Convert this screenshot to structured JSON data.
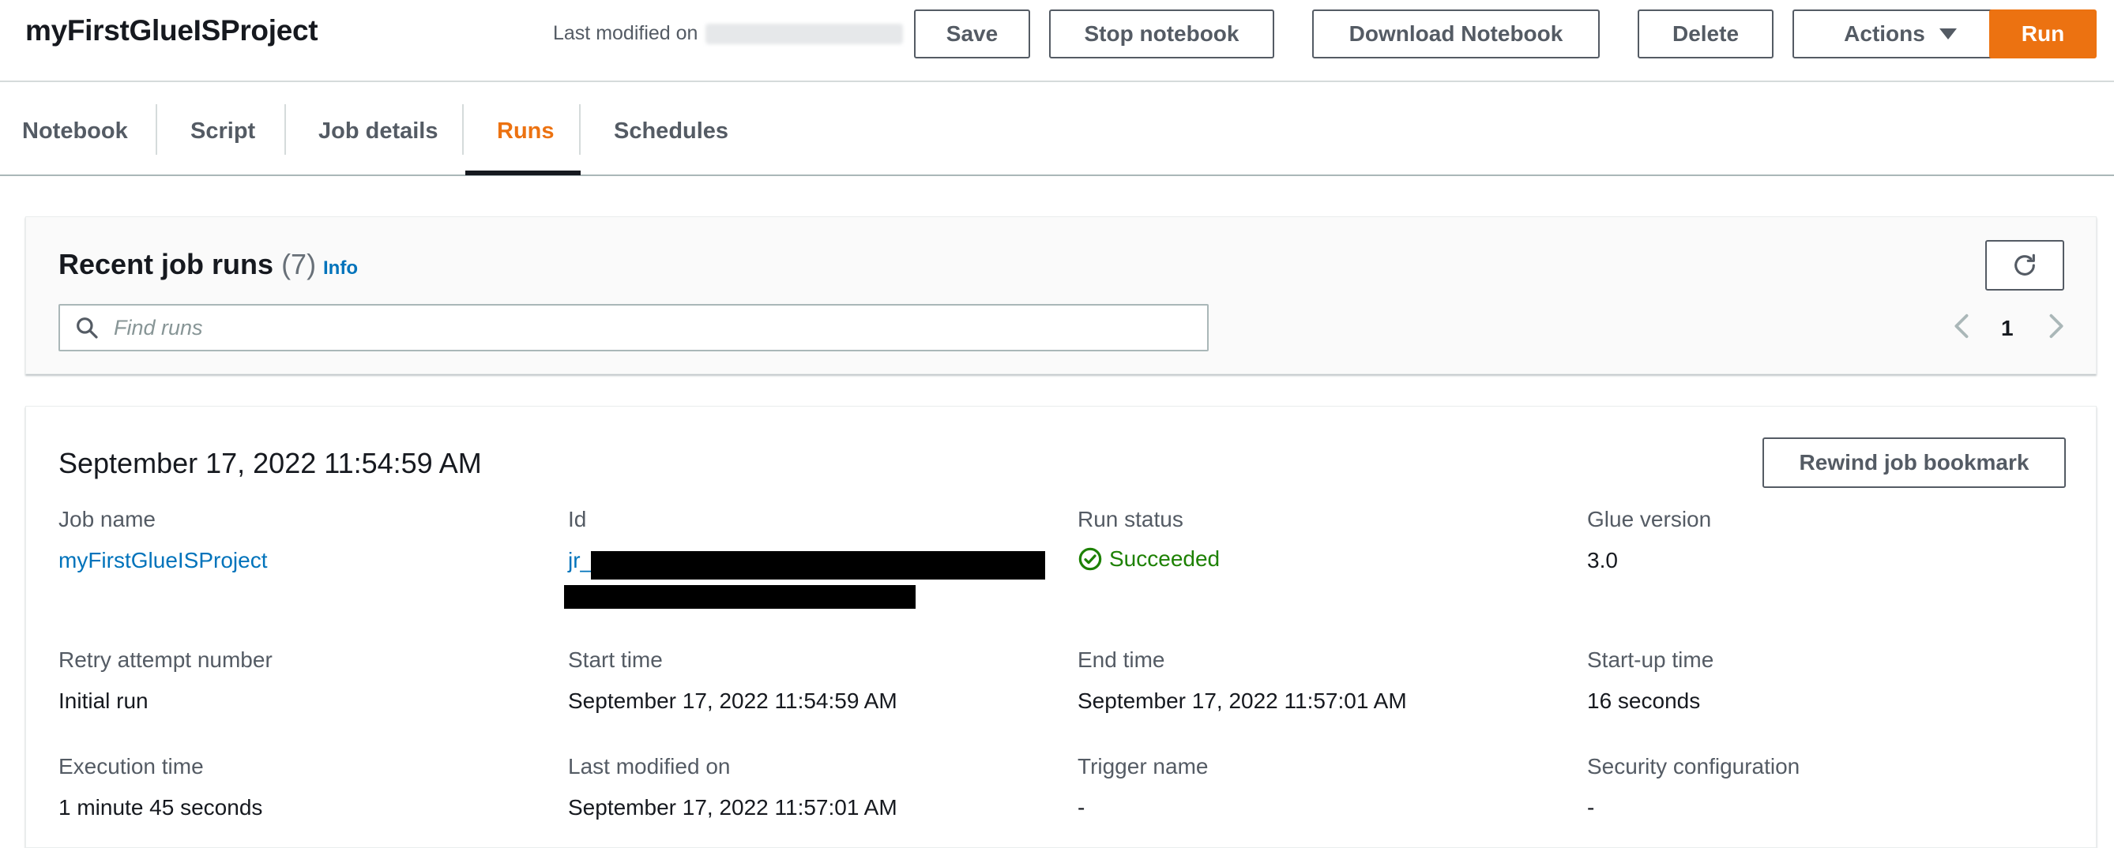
{
  "header": {
    "title": "myFirstGlueISProject",
    "last_modified_label": "Last modified on",
    "buttons": {
      "save": "Save",
      "stop_notebook": "Stop notebook",
      "download_notebook": "Download Notebook",
      "delete": "Delete",
      "actions": "Actions",
      "run": "Run"
    }
  },
  "tabs": [
    {
      "label": "Notebook",
      "active": false
    },
    {
      "label": "Script",
      "active": false
    },
    {
      "label": "Job details",
      "active": false
    },
    {
      "label": "Runs",
      "active": true
    },
    {
      "label": "Schedules",
      "active": false
    }
  ],
  "recent_runs": {
    "title": "Recent job runs",
    "count": "(7)",
    "info_label": "Info",
    "search_placeholder": "Find runs",
    "search_value": "",
    "page": "1"
  },
  "run_detail": {
    "title": "September 17, 2022 11:54:59 AM",
    "rewind_label": "Rewind job bookmark",
    "fields": {
      "job_name": {
        "label": "Job name",
        "value": "myFirstGlueISProject"
      },
      "id": {
        "label": "Id",
        "value": "jr_"
      },
      "run_status": {
        "label": "Run status",
        "value": "Succeeded"
      },
      "glue_version": {
        "label": "Glue version",
        "value": "3.0"
      },
      "retry_attempt": {
        "label": "Retry attempt number",
        "value": "Initial run"
      },
      "start_time": {
        "label": "Start time",
        "value": "September 17, 2022 11:54:59 AM"
      },
      "end_time": {
        "label": "End time",
        "value": "September 17, 2022 11:57:01 AM"
      },
      "startup_time": {
        "label": "Start-up time",
        "value": "16 seconds"
      },
      "execution_time": {
        "label": "Execution time",
        "value": "1 minute 45 seconds"
      },
      "last_modified": {
        "label": "Last modified on",
        "value": "September 17, 2022 11:57:01 AM"
      },
      "trigger_name": {
        "label": "Trigger name",
        "value": "-"
      },
      "security_config": {
        "label": "Security configuration",
        "value": "-"
      }
    }
  },
  "colors": {
    "accent": "#ec7211",
    "link": "#0073bb",
    "success": "#1d8102"
  }
}
